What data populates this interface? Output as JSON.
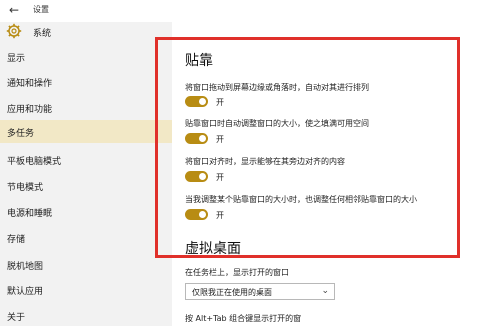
{
  "window": {
    "title": "设置",
    "back_icon": "back-arrow-icon"
  },
  "sidebar": {
    "header": {
      "icon": "gear-icon",
      "label": "系统"
    },
    "items": [
      {
        "label": "显示"
      },
      {
        "label": "通知和操作"
      },
      {
        "label": "应用和功能"
      },
      {
        "label": "多任务",
        "active": true
      },
      {
        "label": "平板电脑模式"
      },
      {
        "label": "节电模式"
      },
      {
        "label": "电源和睡眠"
      },
      {
        "label": "存储"
      },
      {
        "label": "脱机地图"
      },
      {
        "label": "默认应用"
      },
      {
        "label": "关于"
      }
    ]
  },
  "main": {
    "snap": {
      "heading": "贴靠",
      "settings": [
        {
          "desc": "将窗口拖动到屏幕边缘或角落时，自动对其进行排列",
          "state": "开"
        },
        {
          "desc": "贴靠窗口时自动调整窗口的大小，使之填满可用空间",
          "state": "开"
        },
        {
          "desc": "将窗口对齐时，显示能够在其旁边对齐的内容",
          "state": "开"
        },
        {
          "desc": "当我调整某个贴靠窗口的大小时，也调整任何相邻贴靠窗口的大小",
          "state": "开"
        }
      ]
    },
    "virtual_desktops": {
      "heading": "虚拟桌面",
      "taskbar_label": "在任务栏上，显示打开的窗口",
      "taskbar_value": "仅限我正在使用的桌面",
      "alttab_label": "按 Alt+Tab 组合键显示打开的窗"
    }
  },
  "colors": {
    "accent": "#b88c13",
    "active_bg": "#f2e8c6",
    "highlight": "#e0302a"
  }
}
